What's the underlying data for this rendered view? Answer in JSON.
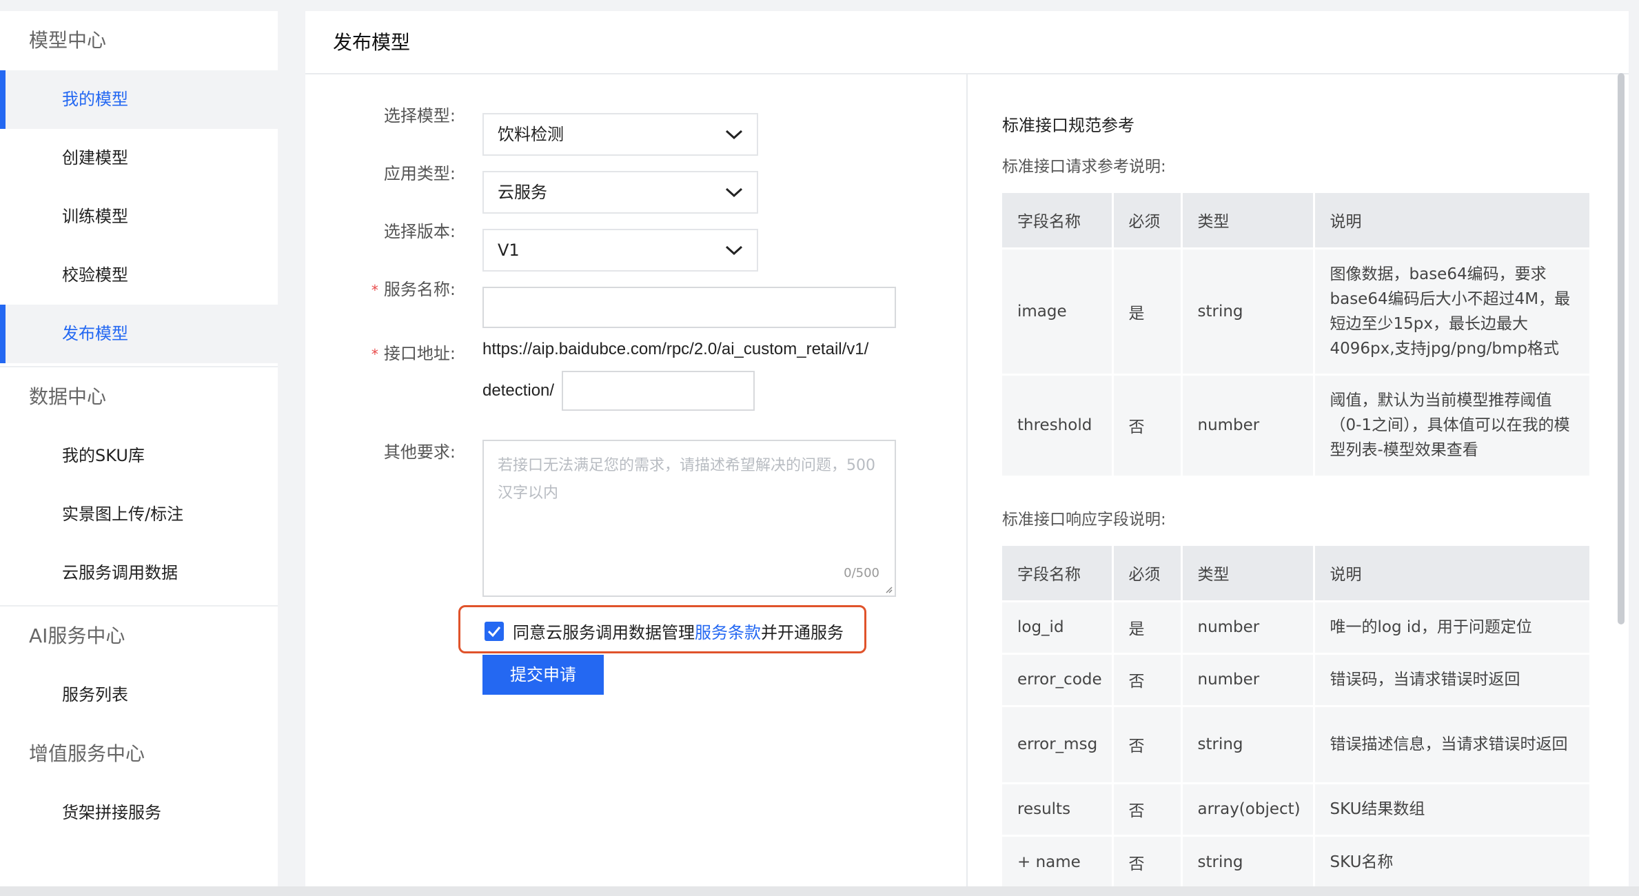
{
  "sidebar": {
    "sections": [
      {
        "title": "模型中心",
        "items": [
          {
            "label": "我的模型",
            "active": true
          },
          {
            "label": "创建模型",
            "active": false
          },
          {
            "label": "训练模型",
            "active": false
          },
          {
            "label": "校验模型",
            "active": false
          },
          {
            "label": "发布模型",
            "active": true
          }
        ]
      },
      {
        "title": "数据中心",
        "items": [
          {
            "label": "我的SKU库",
            "active": false
          },
          {
            "label": "实景图上传/标注",
            "active": false
          },
          {
            "label": "云服务调用数据",
            "active": false
          }
        ]
      },
      {
        "title": "AI服务中心",
        "items": [
          {
            "label": "服务列表",
            "active": false
          }
        ]
      },
      {
        "title": "增值服务中心",
        "items": [
          {
            "label": "货架拼接服务",
            "active": false
          }
        ]
      }
    ]
  },
  "page": {
    "title": "发布模型"
  },
  "form": {
    "model_label": "选择模型:",
    "model_value": "饮料检测",
    "type_label": "应用类型:",
    "type_value": "云服务",
    "version_label": "选择版本:",
    "version_value": "V1",
    "service_name_label": "服务名称:",
    "service_name_value": "",
    "endpoint_label": "接口地址:",
    "endpoint_prefix_line1": "https://aip.baidubce.com/rpc/2.0/ai_custom_retail/v1/",
    "endpoint_prefix_line2": "detection/",
    "endpoint_suffix_value": "",
    "other_label": "其他要求:",
    "other_placeholder": "若接口无法满足您的需求，请描述希望解决的问题，500汉字以内",
    "counter": "0/500",
    "required_mark": "*",
    "agree_prefix": "同意云服务调用数据管理",
    "agree_link": "服务条款",
    "agree_suffix": "并开通服务",
    "agree_checked": true,
    "submit_label": "提交申请"
  },
  "reference": {
    "title": "标准接口规范参考",
    "request_title": "标准接口请求参考说明:",
    "response_title": "标准接口响应字段说明:",
    "headers": [
      "字段名称",
      "必须",
      "类型",
      "说明"
    ],
    "request_rows": [
      [
        "image",
        "是",
        "string",
        "图像数据，base64编码，要求base64编码后大小不超过4M，最短边至少15px，最长边最大4096px,支持jpg/png/bmp格式"
      ],
      [
        "threshold",
        "否",
        "number",
        "阈值，默认为当前模型推荐阈值（0-1之间），具体值可以在我的模型列表-模型效果查看"
      ]
    ],
    "response_rows": [
      [
        "log_id",
        "是",
        "number",
        "唯一的log id，用于问题定位"
      ],
      [
        "error_code",
        "否",
        "number",
        "错误码，当请求错误时返回"
      ],
      [
        "error_msg",
        "否",
        "string",
        "错误描述信息，当请求错误时返回"
      ],
      [
        "results",
        "否",
        "array(object)",
        "SKU结果数组"
      ],
      [
        "+ name",
        "否",
        "string",
        "SKU名称"
      ]
    ]
  },
  "colors": {
    "accent": "#2468f2",
    "highlight_border": "#e0532b",
    "required": "#e84a4a"
  }
}
